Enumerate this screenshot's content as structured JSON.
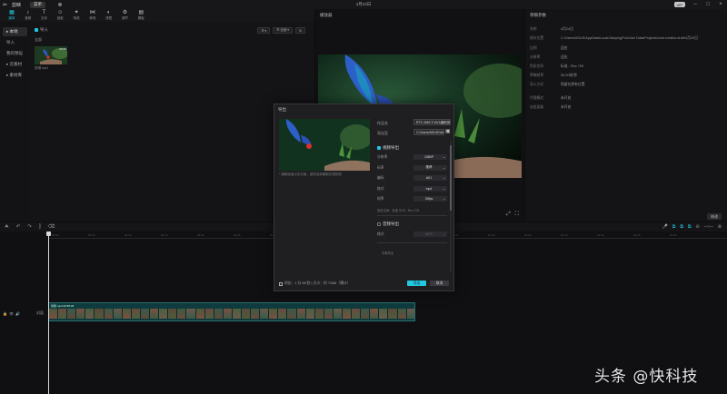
{
  "titlebar": {
    "app_name": "剪映",
    "menu_label": "菜单",
    "doc_title": "4月24日",
    "pro_badge": "VIP",
    "icons": [
      "minimize-icon",
      "maximize-icon",
      "close-icon"
    ]
  },
  "toolbar": {
    "tools": [
      {
        "label": "媒体",
        "icon": "media-icon",
        "active": true
      },
      {
        "label": "音频",
        "icon": "audio-icon"
      },
      {
        "label": "文本",
        "icon": "text-icon"
      },
      {
        "label": "贴纸",
        "icon": "sticker-icon"
      },
      {
        "label": "特效",
        "icon": "effects-icon"
      },
      {
        "label": "转场",
        "icon": "transition-icon"
      },
      {
        "label": "滤镜",
        "icon": "filter-icon"
      },
      {
        "label": "调节",
        "icon": "adjust-icon"
      },
      {
        "label": "模板",
        "icon": "template-icon"
      }
    ]
  },
  "sidebar": {
    "items": [
      {
        "label": "▸ 本地",
        "active": true
      },
      {
        "label": "导入",
        "active": false
      },
      {
        "label": "我的预设",
        "active": false
      },
      {
        "label": "▸ 云素材",
        "active": false
      },
      {
        "label": "▸ 素材库",
        "active": false
      }
    ]
  },
  "media": {
    "import_label": "导入",
    "tool_buttons": [
      "☰ ▾",
      "☰ 全部 ▾",
      "⇅"
    ],
    "section_label": "全部",
    "clip": {
      "duration": "00:58",
      "name": "剪辑.mp4"
    }
  },
  "player": {
    "title": "播放器",
    "controls": [
      "⤢",
      "⛶"
    ]
  },
  "properties": {
    "title": "草稿参数",
    "rows": [
      {
        "k": "名称",
        "v": "4月24日"
      },
      {
        "k": "保存位置",
        "v": "C:/Users/ASUS/AppData/Local/JianyingPro/User Data/Projects/com.lveditor.draft/4月24日"
      },
      {
        "k": "比例",
        "v": "适应"
      },
      {
        "k": "分辨率",
        "v": "适应"
      },
      {
        "k": "色彩空间",
        "v": "标准 - Rec.709"
      },
      {
        "k": "草稿帧率",
        "v": "30.00帧/秒"
      },
      {
        "k": "导入方式",
        "v": "保留在原有位置"
      },
      {
        "k": "代理模式",
        "v": "未开启"
      },
      {
        "k": "自由层级",
        "v": "未开启"
      }
    ],
    "edit_label": "修改"
  },
  "timeline": {
    "ruler": [
      "00:00",
      "00:05",
      "00:10",
      "00:15",
      "00:20",
      "00:25",
      "00:30",
      "00:35",
      "00:40",
      "00:45",
      "00:50",
      "00:55",
      "01:00",
      "01:05",
      "01:10",
      "01:15",
      "01:20",
      "01:25"
    ],
    "track_cover": "封面",
    "clip_label": "剪辑.mp4  00:58:29"
  },
  "export": {
    "title": "导出",
    "hint": "* 编辑画面点击封面，重新选择截取的视频帧",
    "name_label": "作品名",
    "name_value": "RTX 4060 Ti AV1编码测试",
    "path_label": "导出至",
    "path_value": "C:/Users/ASUS/Videos/导出",
    "video_section": "视频导出",
    "video_fields": [
      {
        "label": "分辨率",
        "value": "1080P"
      },
      {
        "label": "码率",
        "value": "推荐"
      },
      {
        "label": "编码",
        "value": "AV1"
      },
      {
        "label": "格式",
        "value": "mp4"
      },
      {
        "label": "帧率",
        "value": "30fps"
      }
    ],
    "color_hint": "色彩空间：标准 SDR - Rec.709",
    "audio_section": "音频导出",
    "audio_fields": [
      {
        "label": "格式",
        "value": "MP3"
      }
    ],
    "more_label": "字幕导出",
    "footer": "时长：1 分 58 秒 | 大小：约 716M（预计）",
    "export_button": "导出",
    "cancel_button": "取消"
  },
  "watermark": "头条 @快科技"
}
